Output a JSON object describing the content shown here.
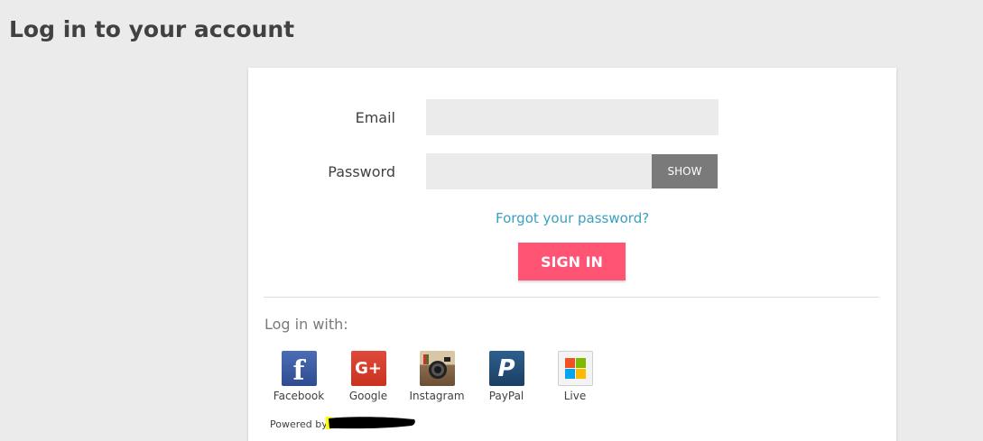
{
  "page": {
    "title": "Log in to your account"
  },
  "form": {
    "email_label": "Email",
    "email_value": "",
    "password_label": "Password",
    "password_value": "",
    "show_label": "SHOW",
    "forgot_label": "Forgot your password?",
    "signin_label": "SIGN IN"
  },
  "social": {
    "heading": "Log in with:",
    "providers": [
      {
        "name": "Facebook",
        "icon": "facebook-icon"
      },
      {
        "name": "Google",
        "icon": "google-plus-icon"
      },
      {
        "name": "Instagram",
        "icon": "instagram-icon"
      },
      {
        "name": "PayPal",
        "icon": "paypal-icon"
      },
      {
        "name": "Live",
        "icon": "windows-live-icon"
      }
    ]
  },
  "footer": {
    "powered_by": "Powered by"
  },
  "colors": {
    "accent": "#ff5474",
    "link": "#3aa0c2",
    "show_button": "#7a7a7a",
    "background": "#ebebeb"
  }
}
